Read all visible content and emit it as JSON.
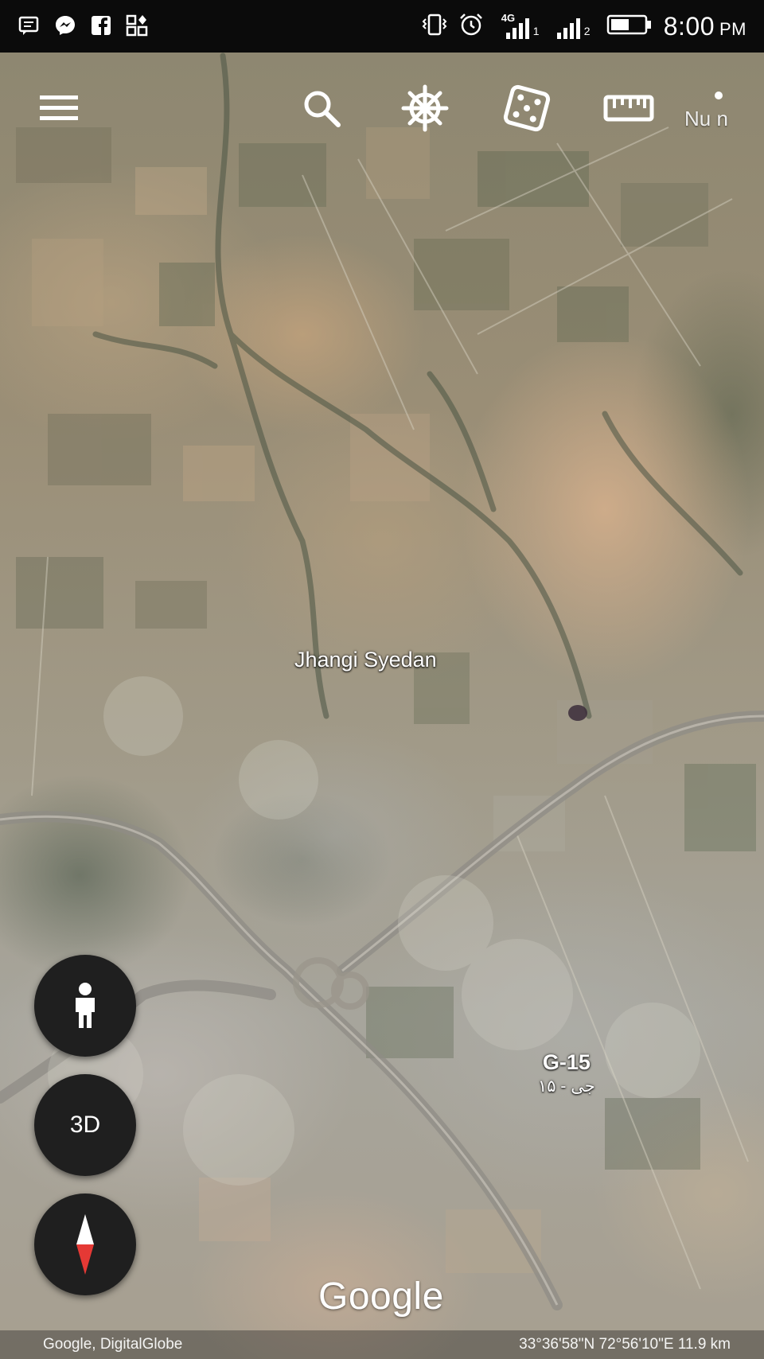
{
  "status_bar": {
    "left_icons": [
      "message-icon",
      "messenger-icon",
      "facebook-icon",
      "apps-icon"
    ],
    "right_icons": [
      "vibrate-icon",
      "alarm-icon",
      "signal-4g-sim1-icon",
      "signal-sim2-icon",
      "battery-icon"
    ],
    "network_label": "4G",
    "sim1_label": "1",
    "sim2_label": "2",
    "time": "8:00",
    "ampm": "PM"
  },
  "toolbar": {
    "items": [
      "menu-icon",
      "search-icon",
      "voyager-wheel-icon",
      "feeling-lucky-dice-icon",
      "measure-ruler-icon",
      "more-options-icon"
    ],
    "partial_label": "Nu n"
  },
  "map": {
    "labels": {
      "town": "Jhangi Syedan",
      "sector": "G-15",
      "sector_urdu": "جی - ۱۵"
    }
  },
  "controls": {
    "street_view": "pegman-icon",
    "three_d_label": "3D",
    "compass": "compass-icon"
  },
  "branding": {
    "logo_text": "Google"
  },
  "footer": {
    "attribution": "Google, DigitalGlobe",
    "coordinates": "33°36'58\"N 72°56'10\"E 11.9 km"
  },
  "colors": {
    "status_bar_bg": "#0b0b0b",
    "fab_bg": "#1f1f1f",
    "compass_north": "#ffffff",
    "compass_south": "#e53935"
  }
}
